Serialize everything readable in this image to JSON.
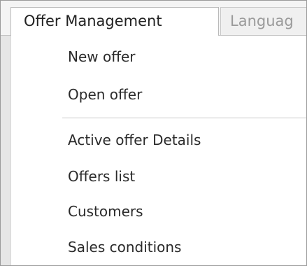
{
  "menubar": {
    "tabs": [
      {
        "label": "Offer Management",
        "active": true
      },
      {
        "label": "Languag",
        "active": false
      }
    ]
  },
  "dropdown": {
    "group1": [
      "New offer",
      "Open offer"
    ],
    "group2": [
      "Active offer Details",
      "Offers list",
      "Customers",
      "Sales conditions"
    ]
  }
}
